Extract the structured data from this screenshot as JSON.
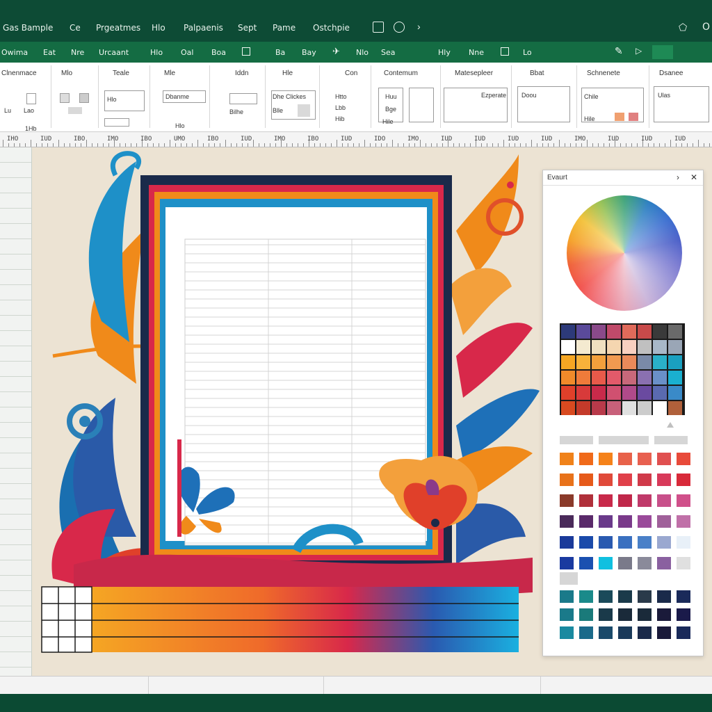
{
  "titlebar": {
    "items": [
      "Gas Bample",
      "Ce",
      "Prgeatmes",
      "Hlo",
      "Palpaenis",
      "Sept",
      "Pame",
      "Ostchpie"
    ],
    "right_label": "O"
  },
  "tabs": [
    "Owima",
    "Eat",
    "Nre",
    "Urcaant",
    "Hlo",
    "Oal",
    "Boa",
    "Ba",
    "Bay",
    "Nlo",
    "Sea",
    "Hly",
    "Nne",
    "Lo"
  ],
  "ribbon": {
    "groups": [
      {
        "title": "Clnenmace",
        "labels": [
          "Lao",
          "Lu",
          "1Hb"
        ]
      },
      {
        "title": "Mlo",
        "labels": []
      },
      {
        "title": "Teale",
        "labels": [
          "Hlo"
        ]
      },
      {
        "title": "Mle",
        "labels": [
          "Dbanme",
          "Hlo"
        ]
      },
      {
        "title": "Iddn",
        "labels": [
          "Bilhe"
        ]
      },
      {
        "title": "Hle",
        "labels": [
          "Dhe Clickes",
          "Blle"
        ]
      },
      {
        "title": "Con",
        "labels": [
          "Htto",
          "Lbb",
          "Hib"
        ]
      },
      {
        "title": "Contemum",
        "labels": [
          "Huu",
          "Bge",
          "Hile"
        ]
      },
      {
        "title": "Matesepleer",
        "labels": [
          "Ezperate"
        ]
      },
      {
        "title": "Bbat",
        "labels": [
          "Doou"
        ]
      },
      {
        "title": "Schnenete",
        "labels": [
          "Chile",
          "Hile"
        ]
      },
      {
        "title": "Dsanee",
        "labels": [
          "Ulas"
        ]
      }
    ]
  },
  "ruler": {
    "labels": [
      "IHO",
      "IUD",
      "IBO",
      "IMO",
      "IBO",
      "UMO",
      "IBO",
      "IUD",
      "IMO",
      "IBO",
      "IUD",
      "IDO",
      "IMO",
      "IUD",
      "IUD",
      "IUD",
      "IUD",
      "IMO",
      "IUD",
      "IUD",
      "IUD"
    ]
  },
  "panel": {
    "title": "Evaurt",
    "colors": {
      "grid": [
        [
          "#2d3a7a",
          "#5a4a9a",
          "#8a4a8a",
          "#c04a6a",
          "#e06a5a",
          "#c84a4a",
          "#3a3a3a",
          "#6a6a6a"
        ],
        [
          "#ffffff",
          "#f4ead0",
          "#f0e0c0",
          "#f5d6b0",
          "#f8d0c0",
          "#c0c0c0",
          "#a8b8c8",
          "#9aa6b6"
        ],
        [
          "#f5a623",
          "#f7b23a",
          "#f3a03c",
          "#f19a50",
          "#ea8a5a",
          "#7a8aa8",
          "#2ab0c8",
          "#1aa0c0"
        ],
        [
          "#f08a2a",
          "#ef7b3a",
          "#e85a4a",
          "#e25a6a",
          "#c8687a",
          "#8a70b0",
          "#6a90c8",
          "#1ab0d0"
        ],
        [
          "#e0402a",
          "#d83a3a",
          "#c82a4a",
          "#d05070",
          "#b04a8a",
          "#6a4aa0",
          "#5a6ab0",
          "#3a8ac8"
        ],
        [
          "#d84a20",
          "#c43a2a",
          "#b83a4a",
          "#c8607a",
          "#e0e0e0",
          "#cccccc",
          "#ffffff",
          "#b0603a"
        ]
      ],
      "palette": [
        [
          "#f0821a",
          "#f06a1a",
          "#f5821a",
          "#e8624a",
          "#e86050",
          "#e05050",
          "#e84a3a"
        ],
        [
          "#e8721a",
          "#e65a1a",
          "#e04a3a",
          "#e0404a",
          "#d03a4a",
          "#d83a5a",
          "#d82a3a"
        ],
        [
          "#8a3a2a",
          "#b0303a",
          "#c82a4a",
          "#c0284a",
          "#c03a6a",
          "#c8508a",
          "#d0508a"
        ],
        [
          "#4a2a5a",
          "#5a2a6a",
          "#6a3a8a",
          "#7a3a8a",
          "#9a4a9a",
          "#a0609a",
          "#c070a8"
        ],
        [
          "#1a3a9a",
          "#1a4aaa",
          "#2a5ab0",
          "#3a70c0",
          "#4a80c8",
          "#9aa8d0",
          "#e8f0f8"
        ],
        [
          "#1a3aa0",
          "#1a50b0",
          "#10c0e0",
          "#7a7a8a",
          "#8a8a9a",
          "#8a60a0",
          "#e0e0e0"
        ]
      ],
      "dark_palette": [
        [
          "#1a7a8a",
          "#1a8a8a",
          "#1a4a5a",
          "#1a3a4a",
          "#2a3a4a",
          "#1a2a4a",
          "#1a2a5a"
        ],
        [
          "#1a7a8a",
          "#1a7a7a",
          "#1a3a4a",
          "#1a2a3a",
          "#1a2a3a",
          "#1a1a3a",
          "#1a1a4a"
        ],
        [
          "#1a8aa0",
          "#1a6a8a",
          "#1a4a6a",
          "#1a3a5a",
          "#1a2a4a",
          "#1a1a3a",
          "#1a2a5a"
        ]
      ]
    }
  },
  "colors": {
    "titlebar": "#0d4b35",
    "tabbar": "#146c43",
    "canvas": "#ece3d3"
  }
}
